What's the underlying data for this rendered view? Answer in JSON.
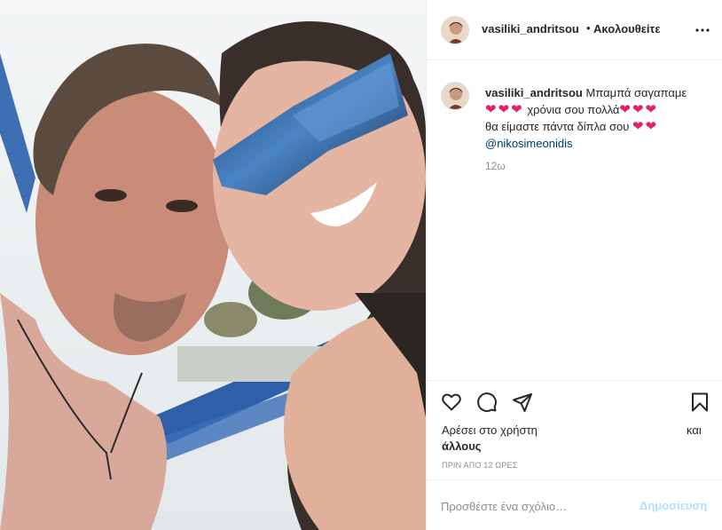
{
  "header": {
    "username": "vasiliki_andritsou",
    "separator": "•",
    "follow_label": "Ακολουθείτε",
    "more_icon": "more-horizontal-icon"
  },
  "caption": {
    "username": "vasiliki_andritsou",
    "text_part1": "Μπαμπά σαγαπαμε",
    "text_part2": "χρόνια σου πολλά",
    "text_part3": "θα είμαστε πάντα δίπλα σου",
    "mention": "@nikosimeonidis",
    "heart_emoji": "❤",
    "time_ago": "12ω"
  },
  "actions": {
    "like_icon": "heart-outline-icon",
    "comment_icon": "comment-bubble-icon",
    "share_icon": "paper-plane-icon",
    "save_icon": "bookmark-icon"
  },
  "likes": {
    "line1": "Αρέσει στο χρήστη",
    "line1_right": "και",
    "line2": "άλλους"
  },
  "post_date": "ΠΡΙΝ ΑΠΟ 12 ΩΡΕΣ",
  "comment": {
    "placeholder": "Προσθέστε ένα σχόλιο…",
    "post_label": "Δημοσίευση"
  },
  "colors": {
    "link": "#00376b",
    "heart": "#e0245e",
    "muted": "#8e8e8e",
    "post_disabled": "#b2dffc"
  }
}
